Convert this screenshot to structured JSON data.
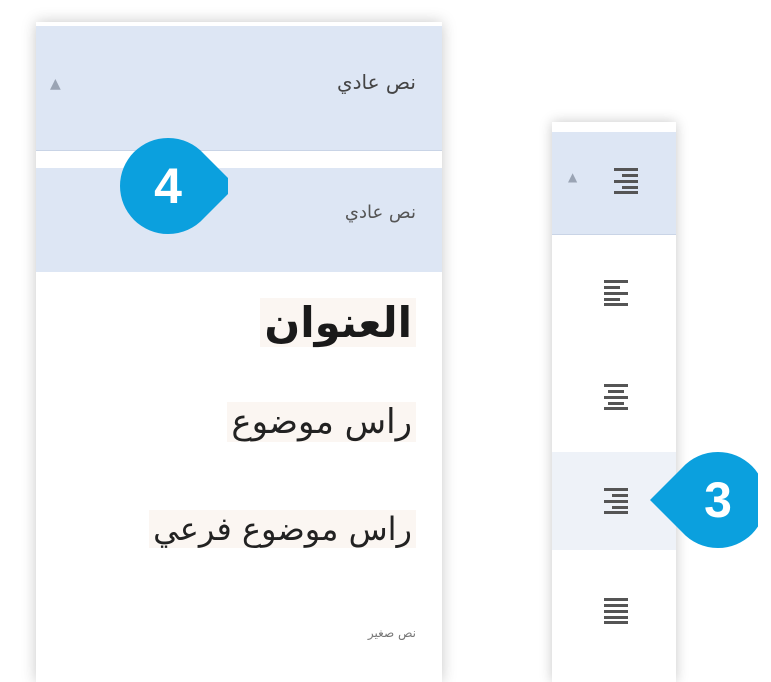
{
  "style_dropdown": {
    "selected_value": "نص عادي",
    "items": [
      "نص عادي",
      "العنوان",
      "راس موضوع",
      "راس موضوع فرعي",
      "نص صغير"
    ]
  },
  "align_dropdown": {
    "selected_icon": "align-right-icon",
    "items": [
      "align-left-icon",
      "align-center-icon",
      "align-right-icon",
      "align-justify-icon"
    ]
  },
  "callouts": {
    "step3": "3",
    "step4": "4"
  },
  "colors": {
    "callout": "#0ba0de",
    "highlight": "#dde6f4"
  }
}
